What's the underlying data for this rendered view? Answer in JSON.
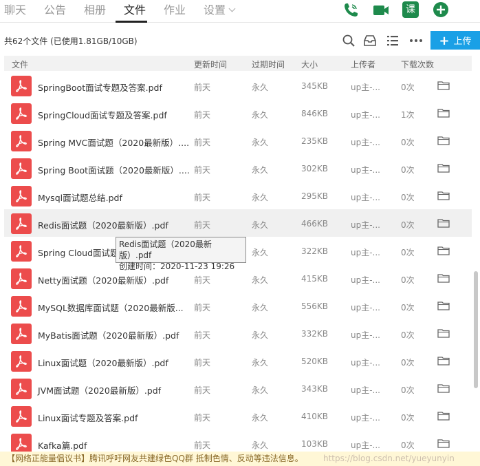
{
  "nav": {
    "tabs": [
      {
        "label": "聊天"
      },
      {
        "label": "公告"
      },
      {
        "label": "相册"
      },
      {
        "label": "文件"
      },
      {
        "label": "作业"
      },
      {
        "label": "设置"
      }
    ],
    "active_tab": "文件",
    "icons": [
      "phone-icon",
      "video-call-icon",
      "course-icon",
      "add-circle-icon"
    ],
    "course_label": "课"
  },
  "toolbar": {
    "summary": "共62个文件 (已使用1.81GB/10GB)",
    "upload_label": "上传",
    "accent": "#1aa0e6"
  },
  "table": {
    "headers": [
      "文件",
      "更新时间",
      "过期时间",
      "大小",
      "上传者",
      "下载次数"
    ],
    "rows": [
      {
        "name": "SpringBoot面试专题及答案.pdf",
        "updated": "前天",
        "expires": "永久",
        "size": "345KB",
        "uploader": "up主-...",
        "downloads": "0次"
      },
      {
        "name": "SpringCloud面试专题及答案.pdf",
        "updated": "前天",
        "expires": "永久",
        "size": "846KB",
        "uploader": "up主-...",
        "downloads": "1次"
      },
      {
        "name": "Spring MVC面试题（2020最新版）....",
        "updated": "前天",
        "expires": "永久",
        "size": "235KB",
        "uploader": "up主-...",
        "downloads": "0次"
      },
      {
        "name": "Spring Boot面试题（2020最新版）....",
        "updated": "前天",
        "expires": "永久",
        "size": "302KB",
        "uploader": "up主-...",
        "downloads": "0次"
      },
      {
        "name": "Mysql面试题总结.pdf",
        "updated": "前天",
        "expires": "永久",
        "size": "295KB",
        "uploader": "up主-...",
        "downloads": "0次"
      },
      {
        "name": "Redis面试题（2020最新版）.pdf",
        "updated": "前天",
        "expires": "永久",
        "size": "466KB",
        "uploader": "up主-...",
        "downloads": "0次"
      },
      {
        "name": "Spring Cloud面试题",
        "updated": "前天",
        "expires": "永久",
        "size": "322KB",
        "uploader": "up主-...",
        "downloads": "0次"
      },
      {
        "name": "Netty面试题（2020最新版）.pdf",
        "updated": "前天",
        "expires": "永久",
        "size": "415KB",
        "uploader": "up主-...",
        "downloads": "0次"
      },
      {
        "name": "MySQL数据库面试题（2020最新版...",
        "updated": "前天",
        "expires": "永久",
        "size": "556KB",
        "uploader": "up主-...",
        "downloads": "0次"
      },
      {
        "name": "MyBatis面试题（2020最新版）.pdf",
        "updated": "前天",
        "expires": "永久",
        "size": "332KB",
        "uploader": "up主-...",
        "downloads": "0次"
      },
      {
        "name": "Linux面试题（2020最新版）.pdf",
        "updated": "前天",
        "expires": "永久",
        "size": "520KB",
        "uploader": "up主-...",
        "downloads": "0次"
      },
      {
        "name": "JVM面试题（2020最新版）.pdf",
        "updated": "前天",
        "expires": "永久",
        "size": "343KB",
        "uploader": "up主-...",
        "downloads": "0次"
      },
      {
        "name": "Linux面试专题及答案.pdf",
        "updated": "前天",
        "expires": "永久",
        "size": "410KB",
        "uploader": "up主-...",
        "downloads": "0次"
      },
      {
        "name": "Kafka篇.pdf",
        "updated": "前天",
        "expires": "永久",
        "size": "103KB",
        "uploader": "up主-...",
        "downloads": "0次"
      }
    ]
  },
  "tooltip": {
    "line1": "Redis面试题（2020最新版）.pdf",
    "line2": "创建时间：2020-11-23 19:26"
  },
  "footer": {
    "notice": "【网络正能量倡议书】腾讯呼吁网友共建绿色QQ群 抵制色情、反动等违法信息。",
    "watermark": "https://blog.csdn.net/yueyunyin"
  },
  "colors": {
    "pdf_icon": "#ec4c4c",
    "course_badge": "#1e8a4c"
  }
}
